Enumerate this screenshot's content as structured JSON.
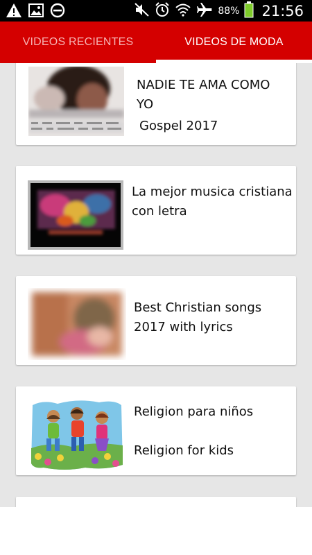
{
  "status_bar": {
    "battery_percent": "88%",
    "time": "21:56",
    "icons": [
      "warning-icon",
      "image-icon",
      "block-icon",
      "mute-icon",
      "alarm-icon",
      "wifi-icon",
      "airplane-icon",
      "battery-icon"
    ]
  },
  "tabs": [
    {
      "label": "VIDEOS RECIENTES",
      "selected": false
    },
    {
      "label": "VIDEOS DE MODA",
      "selected": true
    }
  ],
  "colors": {
    "accent": "#d40000",
    "tab_inactive": "#f6b3b3",
    "tab_active": "#ffffff",
    "list_bg": "#e6e6e6"
  },
  "videos": [
    {
      "title": "NADIE TE AMA COMO YO",
      "subtitle": "Gospel 2017"
    },
    {
      "title": "La mejor musica cristiana con letra",
      "subtitle": ""
    },
    {
      "title": "Best Christian songs 2017 with lyrics",
      "subtitle": ""
    },
    {
      "title": "Religion para niños",
      "subtitle": "Religion for kids"
    }
  ]
}
